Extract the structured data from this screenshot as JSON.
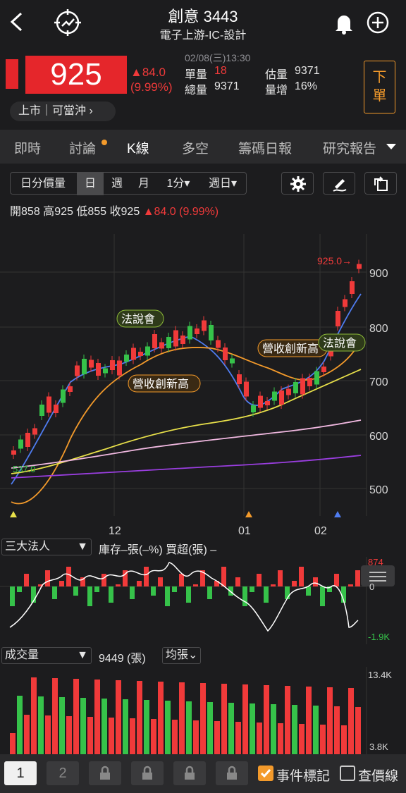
{
  "header": {
    "title": "創意 3443",
    "subtitle": "電子上游-IC-設計"
  },
  "quote": {
    "price": "925",
    "change": "▲84.0",
    "change_pct": "(9.99%)",
    "datetime": "02/08(三)13:30",
    "unit_vol_label": "單量",
    "unit_vol": "18",
    "total_vol_label": "總量",
    "total_vol": "9371",
    "est_vol_label": "估量",
    "est_vol": "9371",
    "vol_inc_label": "量增",
    "vol_inc": "16%",
    "market_tag": "上市｜可當沖 ›",
    "sell_label": "下單"
  },
  "tabs": [
    "即時",
    "討論",
    "K線",
    "多空",
    "籌碼日報",
    "研究報告"
  ],
  "toolbar": {
    "seg": [
      "日分價量",
      "日",
      "週",
      "月",
      "1分▾",
      "週日▾"
    ]
  },
  "ohlc": {
    "open_label": "開",
    "open": "858",
    "high_label": "高",
    "high": "925",
    "low_label": "低",
    "low": "855",
    "close_label": "收",
    "close": "925",
    "chg": "▲84.0 (9.99%)"
  },
  "chart": {
    "last_price_tag": "925.0→",
    "low_tag": "537.0",
    "y_ticks": [
      "900",
      "800",
      "700",
      "600",
      "500"
    ],
    "x_ticks": [
      "12",
      "01",
      "02"
    ],
    "events": [
      "法說會",
      "營收創新高",
      "營收創新高",
      "法說會"
    ]
  },
  "inst": {
    "select": "三大法人",
    "legend": "庫存–張(–%)  買超(張) –",
    "top": "874",
    "zero": "0",
    "bottom": "-1.9K"
  },
  "vol": {
    "select": "成交量",
    "value": "9449 (張)",
    "avg": "均張⌄",
    "top": "13.4K",
    "bottom": "3.8K"
  },
  "bottom": {
    "b1": "1",
    "b2": "2",
    "event_mark": "事件標記",
    "price_line": "查價線"
  },
  "colors": {
    "up": "#f03a3a",
    "down": "#36c24a",
    "accent": "#f39a2b"
  }
}
